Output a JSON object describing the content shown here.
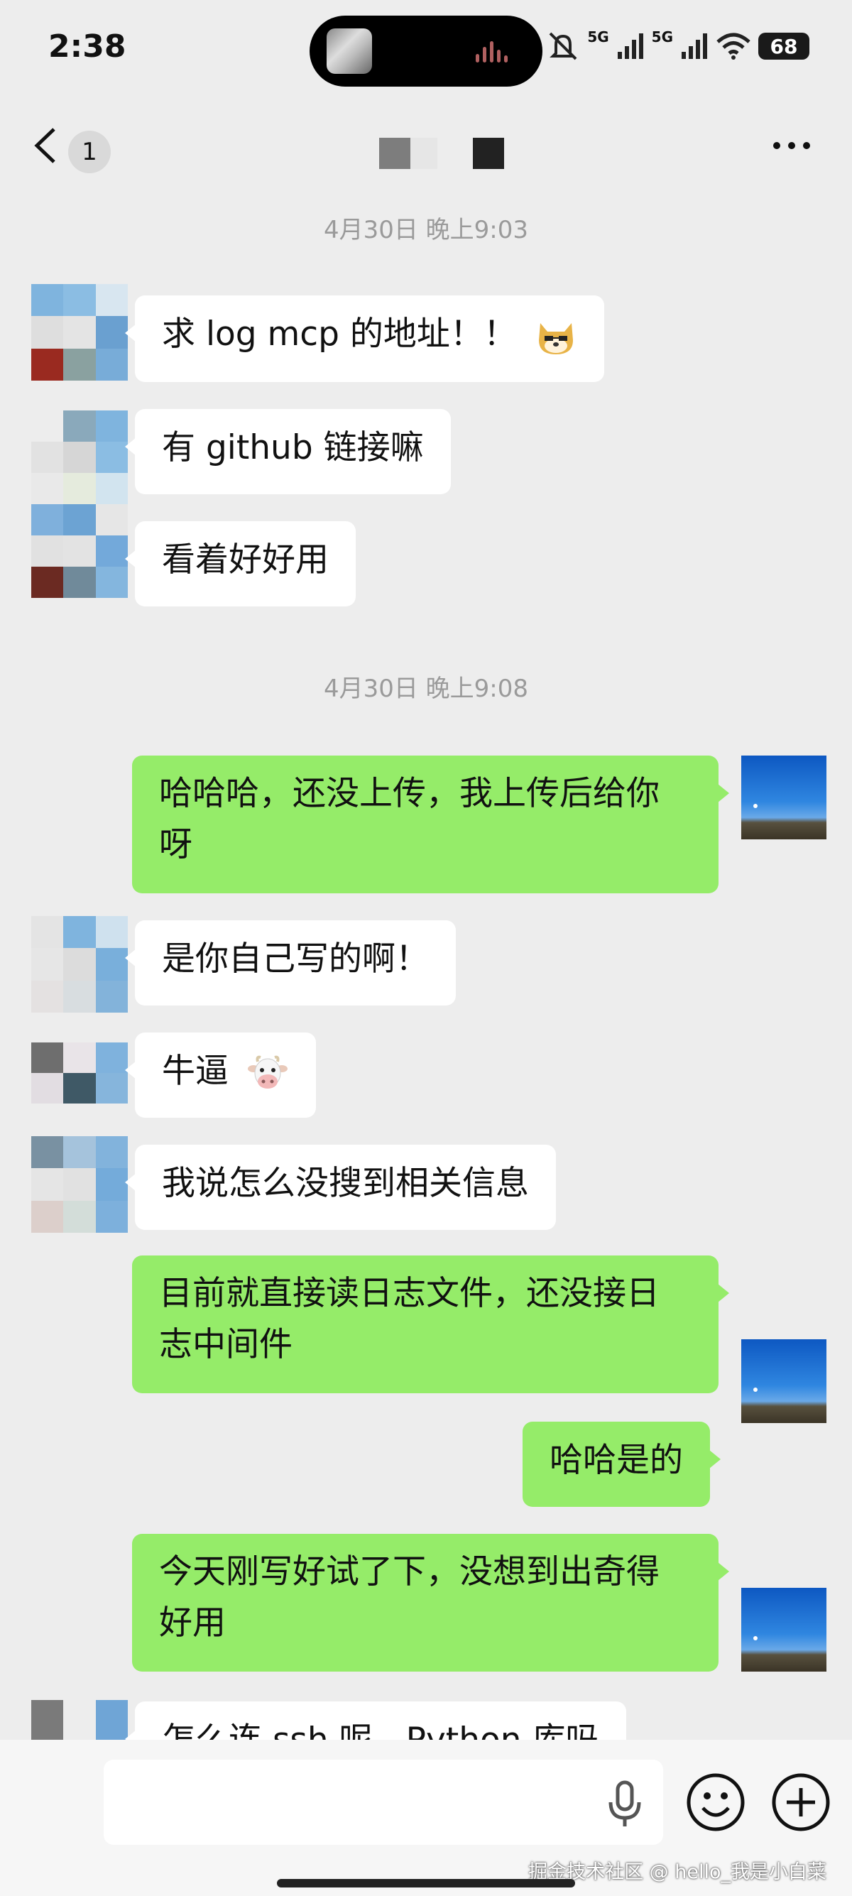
{
  "status_bar": {
    "time": "2:38",
    "battery": "68",
    "network_1": "5G",
    "network_2": "5G",
    "icons": [
      "mute-icon",
      "signal-icon",
      "wifi-icon",
      "battery-icon"
    ]
  },
  "nav": {
    "back_icon": "chevron-left-icon",
    "unread_count": "1",
    "more_icon": "ellipsis-icon"
  },
  "messages": {
    "ts1": "4月30日 晚上9:03",
    "m1": "求 log mcp 的地址！！",
    "m2": "有 github 链接嘛",
    "m3": "看着好好用",
    "ts2": "4月30日 晚上9:08",
    "m4": "哈哈哈，还没上传，我上传后给你呀",
    "m5": "是你自己写的啊！",
    "m6": "牛逼",
    "m7": "我说怎么没搜到相关信息",
    "m8": "目前就直接读日志文件，还没接日志中间件",
    "m9": "哈哈是的",
    "m10": "今天刚写好试了下，没想到出奇得好用",
    "m11": "怎么连 ssh 呢，Python 库吗"
  },
  "input_bar": {
    "voice_icon": "microphone-icon",
    "emoji_icon": "smiley-icon",
    "more_icon": "plus-circle-icon",
    "watermark": "掘金技术社区 @ hello_我是小白菜"
  },
  "colors": {
    "background": "#ededed",
    "outgoing_bubble": "#95ec69",
    "incoming_bubble": "#ffffff",
    "timestamp": "#9a9a9a"
  }
}
